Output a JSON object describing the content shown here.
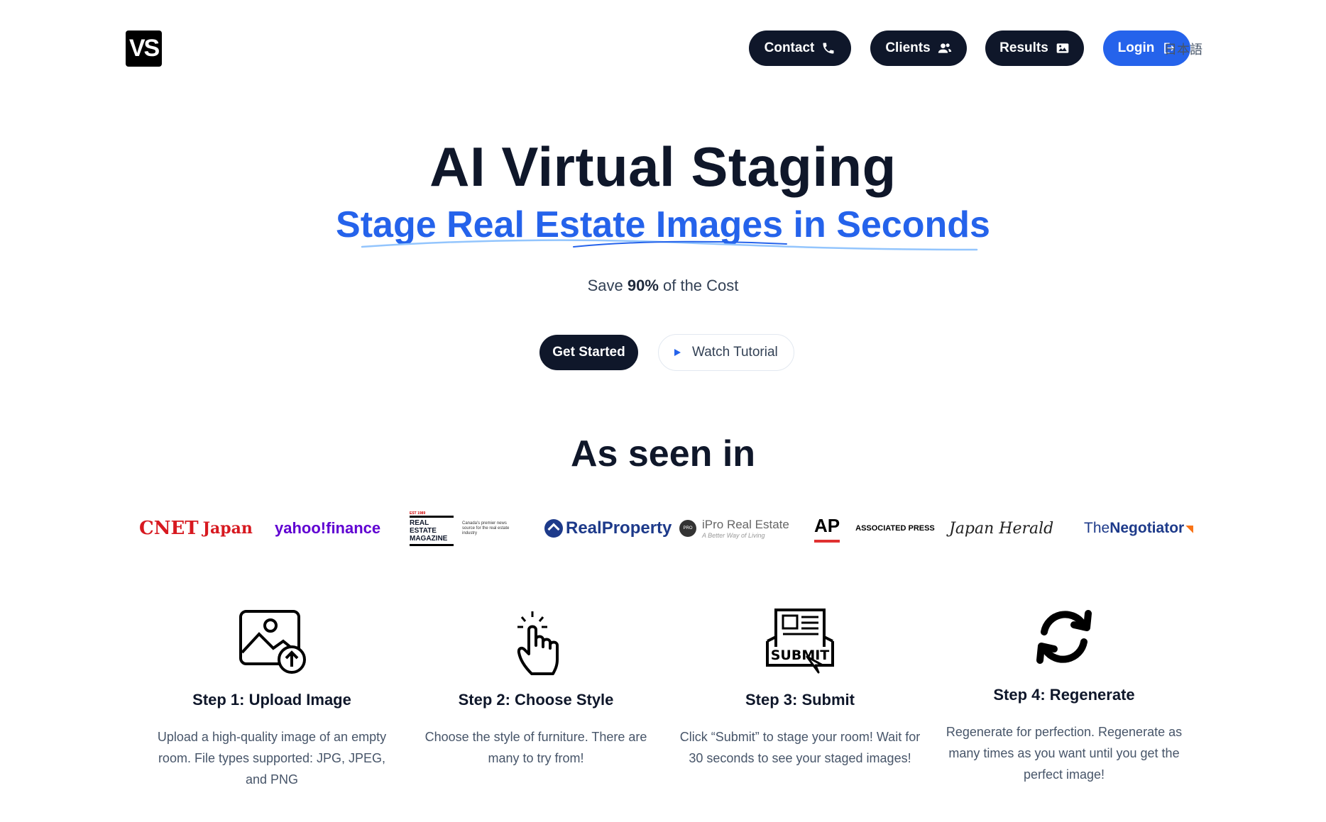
{
  "header": {
    "logo_text": "VS",
    "nav": [
      {
        "label": "Contact",
        "icon": "phone-icon"
      },
      {
        "label": "Clients",
        "icon": "users-icon"
      },
      {
        "label": "Results",
        "icon": "image-icon"
      },
      {
        "label": "Login",
        "icon": "login-icon"
      }
    ],
    "language": "日本語"
  },
  "hero": {
    "title": "AI Virtual Staging",
    "subtitle": "Stage Real Estate Images in Seconds",
    "save_prefix": "Save ",
    "save_value": "90%",
    "save_suffix": " of the Cost",
    "primary_cta": "Get Started",
    "secondary_cta": "Watch Tutorial"
  },
  "press": {
    "heading": "As seen in",
    "logos": [
      {
        "name": "CNET",
        "suffix": "Japan"
      },
      {
        "name": "yahoo!finance"
      },
      {
        "name": "REAL ESTATE MAGAZINE",
        "badge": "EST 1989",
        "tagline": "Canada's premier news source for the real estate industry"
      },
      {
        "name": "RealProperty"
      },
      {
        "name": "iPro Real Estate",
        "badge": "PRO",
        "tagline": "A Better Way of Living"
      },
      {
        "name": "AP",
        "suffix": "ASSOCIATED PRESS"
      },
      {
        "name": "Japan Herald"
      },
      {
        "prefix": "The",
        "name": "Negotiator"
      }
    ]
  },
  "steps": [
    {
      "icon": "upload-image-icon",
      "title": "Step 1: Upload Image",
      "text": "Upload a high-quality image of an empty room. File types supported: JPG, JPEG, and PNG"
    },
    {
      "icon": "pointer-hand-icon",
      "title": "Step 2: Choose Style",
      "text": "Choose the style of furniture. There are many to try from!"
    },
    {
      "icon": "submit-icon",
      "title": "Step 3: Submit",
      "text": "Click “Submit” to stage your room! Wait for 30 seconds to see your staged images!",
      "icon_text": "SUBMIT"
    },
    {
      "icon": "regenerate-icon",
      "title": "Step 4: Regenerate",
      "text": "Regenerate for perfection. Regenerate as many times as you want until you get the perfect image!"
    }
  ],
  "colors": {
    "primary": "#0f172a",
    "accent": "#2563eb",
    "body_text": "#475569"
  }
}
